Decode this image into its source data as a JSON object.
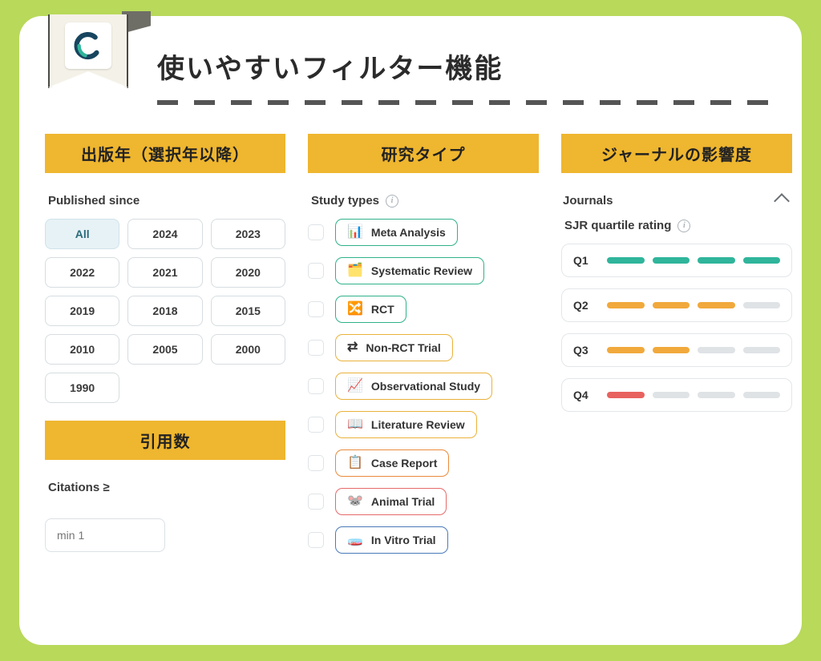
{
  "header": {
    "title": "使いやすいフィルター機能"
  },
  "columns": {
    "published": {
      "header": "出版年（選択年以降）",
      "label": "Published since",
      "options": [
        "All",
        "2024",
        "2023",
        "2022",
        "2021",
        "2020",
        "2019",
        "2018",
        "2015",
        "2010",
        "2005",
        "2000",
        "1990"
      ],
      "selected": "All"
    },
    "citations": {
      "header": "引用数",
      "label": "Citations  ≥",
      "placeholder": "min 1"
    },
    "study_types": {
      "header": "研究タイプ",
      "label": "Study types",
      "items": [
        {
          "label": "Meta Analysis",
          "emoji": "📊",
          "color": "c-green"
        },
        {
          "label": "Systematic Review",
          "emoji": "🗂️",
          "color": "c-green"
        },
        {
          "label": "RCT",
          "emoji": "🔀",
          "color": "c-green"
        },
        {
          "label": "Non-RCT Trial",
          "emoji": "⇄",
          "color": "c-amber"
        },
        {
          "label": "Observational Study",
          "emoji": "📈",
          "color": "c-amber"
        },
        {
          "label": "Literature Review",
          "emoji": "📖",
          "color": "c-amber"
        },
        {
          "label": "Case Report",
          "emoji": "📋",
          "color": "c-orange"
        },
        {
          "label": "Animal Trial",
          "emoji": "🐭",
          "color": "c-red"
        },
        {
          "label": "In Vitro Trial",
          "emoji": "🧫",
          "color": "c-blue"
        }
      ]
    },
    "journals": {
      "header": "ジャーナルの影響度",
      "section_label": "Journals",
      "rating_label": "SJR quartile rating",
      "rows": [
        {
          "label": "Q1",
          "segs": [
            "seg-teal",
            "seg-teal",
            "seg-teal",
            "seg-teal"
          ]
        },
        {
          "label": "Q2",
          "segs": [
            "seg-amber",
            "seg-amber",
            "seg-amber",
            "seg-muted"
          ]
        },
        {
          "label": "Q3",
          "segs": [
            "seg-amber",
            "seg-amber",
            "seg-muted",
            "seg-muted"
          ]
        },
        {
          "label": "Q4",
          "segs": [
            "seg-red",
            "seg-muted",
            "seg-muted",
            "seg-muted"
          ]
        }
      ]
    }
  }
}
